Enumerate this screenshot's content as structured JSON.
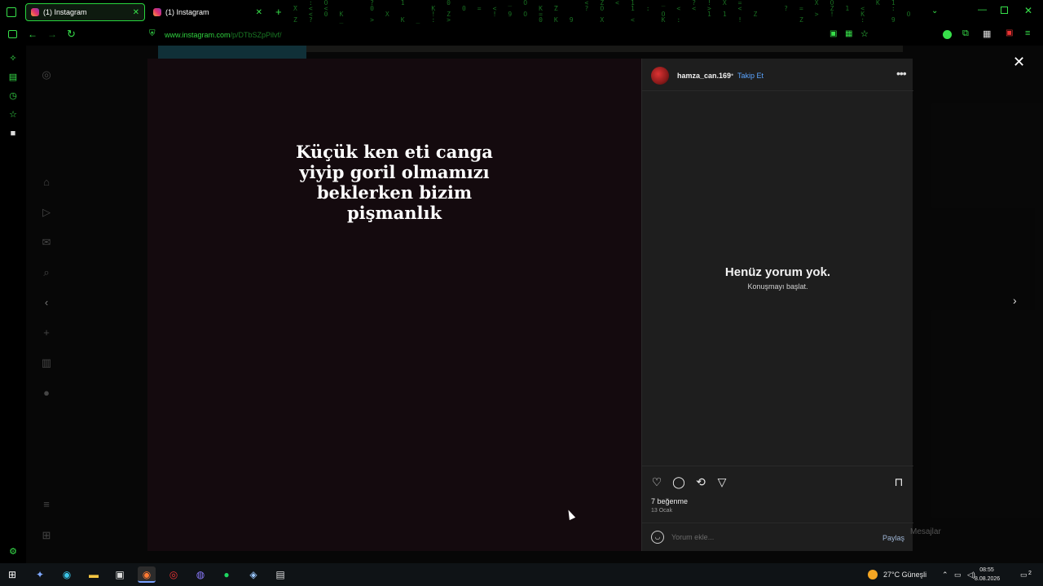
{
  "browser": {
    "tabs": [
      {
        "label": "(1) Instagram",
        "active": true
      },
      {
        "label": "(1) Instagram",
        "active": false
      }
    ],
    "url_prefix": "www.instagram.com",
    "url_path": "/p/DTbSZpPilvf/",
    "accent_color": "#37e04a"
  },
  "post": {
    "caption": "Küçük ken eti canga yiyip goril olmamızı beklerken bizim pişmanlık",
    "username": "hamza_can.169",
    "separator": "•",
    "follow_label": "Takip Et",
    "more_icon": "ellipsis-icon",
    "no_comments_title": "Henüz yorum yok.",
    "no_comments_subtitle": "Konuşmayı başlat.",
    "likes_text": "7 beğenme",
    "date_text": "13 Ocak",
    "comment_placeholder": "Yorum ekle...",
    "share_label": "Paylaş"
  },
  "page": {
    "messages_label": "Mesajlar"
  },
  "taskbar": {
    "weather": "27°C  Güneşli",
    "time": "08:55",
    "date": "8.08.2026",
    "notifications": "2"
  }
}
